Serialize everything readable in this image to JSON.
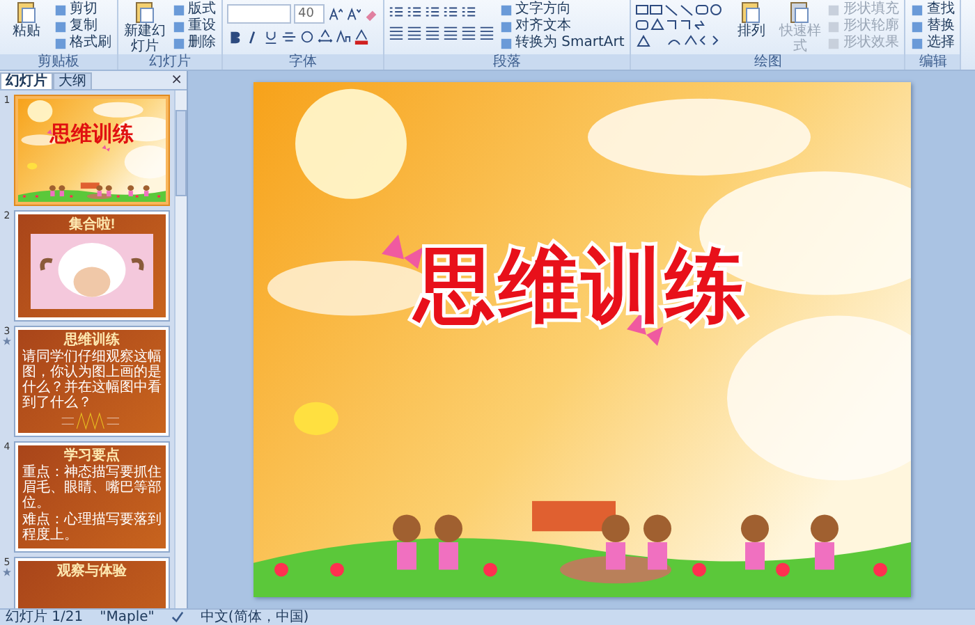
{
  "ribbon": {
    "groups": [
      {
        "label": "剪贴板",
        "kind": "clipboard",
        "buttons": [
          {
            "label": "粘贴",
            "kind": "large",
            "disabled": false
          },
          {
            "label": "剪切",
            "kind": "small",
            "disabled": false
          },
          {
            "label": "复制",
            "kind": "small",
            "disabled": false
          },
          {
            "label": "格式刷",
            "kind": "small",
            "disabled": false
          }
        ]
      },
      {
        "label": "幻灯片",
        "kind": "slides",
        "buttons": [
          {
            "label": "新建幻灯片",
            "kind": "large",
            "disabled": false
          },
          {
            "label": "版式",
            "kind": "small",
            "disabled": false
          },
          {
            "label": "重设",
            "kind": "small",
            "disabled": false
          },
          {
            "label": "删除",
            "kind": "small",
            "disabled": false
          }
        ]
      },
      {
        "label": "字体",
        "kind": "font",
        "font_size": "40"
      },
      {
        "label": "段落",
        "kind": "paragraph",
        "buttons": [
          {
            "label": "文字方向",
            "kind": "small",
            "disabled": false
          },
          {
            "label": "对齐文本",
            "kind": "small",
            "disabled": false
          },
          {
            "label": "转换为 SmartArt",
            "kind": "small",
            "disabled": false
          }
        ]
      },
      {
        "label": "绘图",
        "kind": "drawing",
        "buttons": [
          {
            "label": "排列",
            "kind": "large",
            "disabled": false
          },
          {
            "label": "快速样式",
            "kind": "large",
            "disabled": true
          },
          {
            "label": "形状填充",
            "kind": "small",
            "disabled": true
          },
          {
            "label": "形状轮廓",
            "kind": "small",
            "disabled": true
          },
          {
            "label": "形状效果",
            "kind": "small",
            "disabled": true
          }
        ]
      },
      {
        "label": "编辑",
        "kind": "editing",
        "buttons": [
          {
            "label": "查找",
            "kind": "small",
            "disabled": false
          },
          {
            "label": "替换",
            "kind": "small",
            "disabled": false
          },
          {
            "label": "选择",
            "kind": "small",
            "disabled": false
          }
        ]
      }
    ]
  },
  "panel": {
    "tabs": [
      {
        "label": "幻灯片",
        "selected": true
      },
      {
        "label": "大纲",
        "selected": false
      }
    ],
    "close": "×"
  },
  "slides": [
    {
      "number": "1",
      "kind": "title",
      "selected": true,
      "animated": false,
      "title": "思维训练"
    },
    {
      "number": "2",
      "selected": false,
      "animated": false,
      "title": "集合啦!"
    },
    {
      "number": "3",
      "kind": "diagram",
      "selected": false,
      "animated": true,
      "title": "思维训练",
      "bullets": [
        "请同学们仔细观察这幅图，你认为图上画的是什么？并在这幅图中看到了什么？"
      ]
    },
    {
      "number": "4",
      "kind": "bullets",
      "selected": false,
      "animated": false,
      "title": "学习要点",
      "bullets": [
        "重点：神态描写要抓住眉毛、眼睛、嘴巴等部位。",
        "难点：心理描写要落到程度上。"
      ]
    },
    {
      "number": "5",
      "kind": "bullets",
      "selected": false,
      "animated": true,
      "title": "观察与体验"
    }
  ],
  "main_slide": {
    "title": "思维训练"
  },
  "status_bar": {
    "items": [
      "幻灯片 1/21",
      "\"Maple\"",
      "中文(简体，中国)"
    ]
  }
}
